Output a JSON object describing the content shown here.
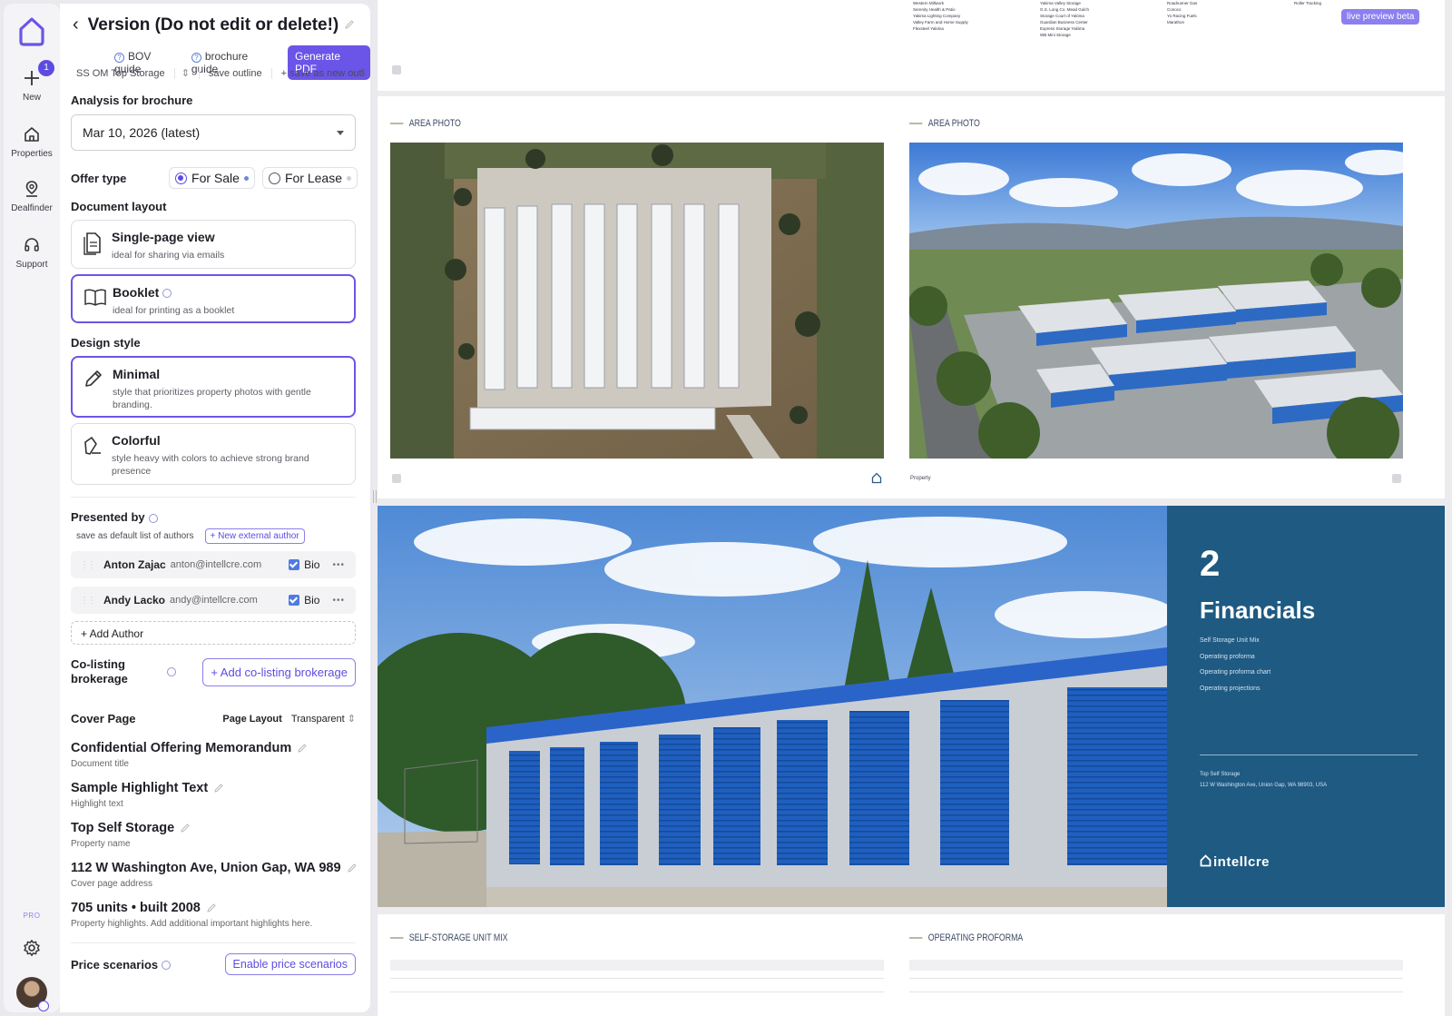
{
  "rail": {
    "items": [
      {
        "label": "New",
        "badge": "1"
      },
      {
        "label": "Properties"
      },
      {
        "label": "Dealfinder"
      },
      {
        "label": "Support"
      }
    ],
    "pro": "PRO"
  },
  "panel": {
    "title": "Version (Do not edit or delete!)",
    "bov_guide": "BOV guide",
    "brochure_guide": "brochure guide",
    "generate_pdf": "Generate PDF",
    "outline_name": "SS OM Top Storage",
    "save_outline": "save outline",
    "save_new_outline": "+ save as new outline",
    "analysis_label": "Analysis for brochure",
    "analysis_value": "Mar 10, 2026 (latest)",
    "offer_type_label": "Offer type",
    "offer_options": [
      "For Sale",
      "For Lease"
    ],
    "offer_selected": "For Sale",
    "document_layout_label": "Document layout",
    "layouts": [
      {
        "title": "Single-page view",
        "subtitle": "ideal for sharing via emails"
      },
      {
        "title": "Booklet",
        "subtitle": "ideal for printing as a booklet"
      }
    ],
    "design_style_label": "Design style",
    "styles": [
      {
        "title": "Minimal",
        "subtitle": "style that prioritizes property photos with gentle branding."
      },
      {
        "title": "Colorful",
        "subtitle": "style heavy with colors to achieve strong brand presence"
      }
    ],
    "presented_by_label": "Presented by",
    "save_default_authors": "save as default list of authors",
    "new_external_author": "+ New external author",
    "authors": [
      {
        "name": "Anton Zajac",
        "email": "anton@intellcre.com",
        "bio": "Bio"
      },
      {
        "name": "Andy Lacko",
        "email": "andy@intellcre.com",
        "bio": "Bio"
      }
    ],
    "add_author": "+ Add Author",
    "colisting_label": "Co-listing brokerage",
    "add_colisting": "+ Add co-listing brokerage",
    "cover_page_label": "Cover Page",
    "page_layout_label": "Page Layout",
    "page_layout_value": "Transparent",
    "fields": [
      {
        "value": "Confidential Offering Memorandum",
        "hint": "Document title"
      },
      {
        "value": "Sample Highlight Text",
        "hint": "Highlight text"
      },
      {
        "value": "Top Self Storage",
        "hint": "Property name"
      },
      {
        "value": "112 W Washington Ave, Union Gap, WA 989",
        "hint": "Cover page address"
      },
      {
        "value": "705 units • built 2008",
        "hint": "Property highlights. Add additional important highlights here."
      }
    ],
    "price_scenarios_label": "Price scenarios",
    "enable_price_scenarios": "Enable price scenarios"
  },
  "preview": {
    "beta_badge": "live preview beta",
    "area_photo_1": "AREA PHOTO",
    "area_photo_2": "AREA PHOTO",
    "page_footer_right": "Property",
    "financials_number": "2",
    "financials_title": "Financials",
    "financials_items": [
      "Self Storage Unit Mix",
      "Operating proforma",
      "Operating proforma chart",
      "Operating projections"
    ],
    "property_line1": "Top Self Storage",
    "property_line2": "112 W Washington Ave, Union Gap, WA 98903, USA",
    "brand": "intellcre",
    "unit_mix_header": "SELF-STORAGE UNIT MIX",
    "proforma_header": "OPERATING PROFORMA",
    "legend_col1": [
      "Western Millwork",
      "Serenity Health & Patio",
      "Yakima Lighting Company",
      "Valley Farm and Home Supply",
      "Flexsteel Yakima"
    ],
    "legend_col2": [
      "Yakima Valley Storage",
      "G.S. Long Co. Mead Gulch",
      "Storage Court of Yakima",
      "Guardian Business Center",
      "Express Storage Yakima",
      "WB Mini Storage"
    ],
    "legend_col3": [
      "Roadrunner Gas",
      "Conoco",
      "Yo Racing Fuels",
      "Marathon"
    ],
    "legend_col4": [
      "Roller Tracking"
    ]
  },
  "colors": {
    "accent": "#6a55e8",
    "financials_panel": "#1e5a82",
    "door_blue": "#1f5fbf"
  }
}
